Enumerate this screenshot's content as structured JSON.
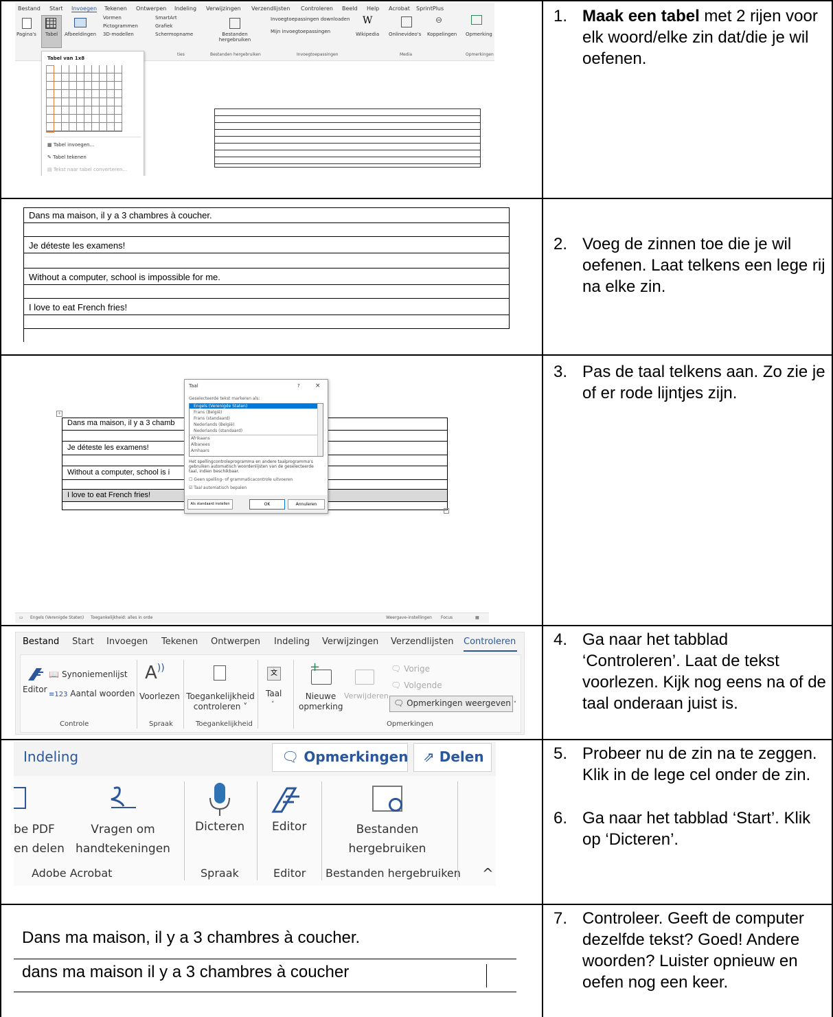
{
  "steps": {
    "s1": {
      "num": "1.",
      "bold": "Maak een tabel",
      "rest": " met 2 rijen voor elk woord/elke zin dat/die je wil oefenen."
    },
    "s2": {
      "num": "2.",
      "text": "Voeg de zinnen toe die je wil oefenen. Laat telkens een lege rij na elke zin."
    },
    "s3": {
      "num": "3.",
      "text": "Pas de taal telkens aan. Zo zie je of er rode lijntjes zijn."
    },
    "s4": {
      "num": "4.",
      "text": "Ga naar het tabblad ‘Controleren’. Laat de tekst voorlezen. Kijk nog eens na of de taal onderaan juist is."
    },
    "s5": {
      "num": "5.",
      "text": "Probeer nu de zin na te zeggen. Klik in de lege cel onder de zin."
    },
    "s6": {
      "num": "6.",
      "text": "Ga naar het tabblad ‘Start’. Klik op ‘Dicteren’."
    },
    "s7": {
      "num": "7.",
      "text": "Controleer. Geeft de computer dezelfde tekst? Goed! Andere woorden? Luister opnieuw en oefen nog een keer."
    }
  },
  "ribbon1": {
    "tabs": [
      "Bestand",
      "Start",
      "Invoegen",
      "Tekenen",
      "Ontwerpen",
      "Indeling",
      "Verwijzingen",
      "Verzendlijsten",
      "Controleren",
      "Beeld",
      "Help",
      "Acrobat",
      "SprintPlus"
    ],
    "buttons": {
      "paginas": "Pagina's",
      "tabel": "Tabel",
      "afbeeldingen": "Afbeeldingen",
      "vormen": "Vormen",
      "pictogrammen": "Pictogrammen",
      "modellen3d": "3D-modellen",
      "smartart": "SmartArt",
      "grafiek": "Grafiek",
      "schermopname": "Schermopname",
      "bestanden": "Bestanden hergebruiken",
      "invoeg_download": "Invoegtoepassingen downloaden",
      "mijn_invoeg": "Mijn invoegtoepassingen",
      "wikipedia": "Wikipedia",
      "onlinevideos": "Onlinevideo's",
      "koppelingen": "Koppelingen",
      "opmerking": "Opmerking"
    },
    "groups": {
      "illustraties": "ties",
      "bestanden": "Bestanden hergebruiken",
      "invoeg": "Invoegtoepassingen",
      "media": "Media",
      "opmerkingen": "Opmerkingen"
    },
    "dropdown": {
      "title": "Tabel van 1x8",
      "insert": "Tabel invoegen...",
      "draw": "Tabel tekenen",
      "convert": "Tekst naar tabel converteren..."
    }
  },
  "table2": {
    "rows": [
      "Dans ma maison, il y a 3 chambres à coucher.",
      "Je déteste les examens!",
      "Without a computer, school is impossible for me.",
      "I love to eat French fries!"
    ]
  },
  "table3": {
    "rows": [
      "Dans ma maison, il y a 3 chamb",
      "Je déteste les examens!",
      "Without a computer, school is i",
      "I love to eat French fries!"
    ]
  },
  "dialog": {
    "title": "Taal",
    "help": "?",
    "close": "×",
    "prompt": "Geselecteerde tekst markeren als:",
    "languages": [
      "Engels (Verenigde Staten)",
      "Frans (België)",
      "Frans (standaard)",
      "Nederlands (België)",
      "Nederlands (standaard)",
      "Afrikaans",
      "Albanees",
      "Amhaars"
    ],
    "info": "Het spellingcontroleprogramma en andere taalprogramma's gebruiken automatisch woordenlijsten van de geselecteerde taal, indien beschikbaar.",
    "check1": "Geen spelling- of grammaticacontrole uitvoeren",
    "check2": "Taal automatisch bepalen",
    "btn_default": "Als standaard instellen",
    "btn_ok": "OK",
    "btn_cancel": "Annuleren"
  },
  "statusbar": {
    "lang": "Engels (Verenigde Staten)",
    "access": "Toegankelijkheid: alles in orde",
    "display": "Weergave-instellingen",
    "focus": "Focus"
  },
  "ribbon4": {
    "tabs": [
      "Bestand",
      "Start",
      "Invoegen",
      "Tekenen",
      "Ontwerpen",
      "Indeling",
      "Verwijzingen",
      "Verzendlijsten",
      "Controleren"
    ],
    "editor": "Editor",
    "synoniemen": "Synoniemenlijst",
    "aantal": "Aantal woorden",
    "voorlezen": "Voorlezen",
    "toeg1": "Toegankelijkheid",
    "toeg2": "controleren ˅",
    "taal": "Taal",
    "nieuwe1": "Nieuwe",
    "nieuwe2": "opmerking",
    "verwijderen": "Verwijderen",
    "vorige": "Vorige",
    "volgende": "Volgende",
    "weergeven": "Opmerkingen weergeven",
    "groups": [
      "Controle",
      "Spraak",
      "Toegankelijkheid",
      "Opmerkingen"
    ]
  },
  "ribbon5": {
    "tab": "Indeling",
    "opmerkingen": "Opmerkingen",
    "delen": "Delen",
    "pdf1": "be PDF",
    "pdf2": "en delen",
    "vragen1": "Vragen om",
    "vragen2": "handtekeningen",
    "dicteren": "Dicteren",
    "editor": "Editor",
    "best1": "Bestanden",
    "best2": "hergebruiken",
    "groups": [
      "Adobe Acrobat",
      "Spraak",
      "Editor",
      "Bestanden hergebruiken"
    ]
  },
  "dictation": {
    "line1": "Dans ma maison, il y a 3 chambres à coucher.",
    "line2": "dans ma maison il y a 3 chambres à coucher"
  },
  "colors": {
    "accent": "#2b579a",
    "orange": "#e07b39",
    "mic": "#2e74b5"
  }
}
